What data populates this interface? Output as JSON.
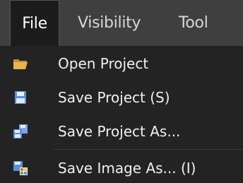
{
  "menubar": {
    "items": [
      {
        "label": "File",
        "active": true
      },
      {
        "label": "Visibility",
        "active": false
      },
      {
        "label": "Tool",
        "active": false
      }
    ]
  },
  "file_menu": {
    "items": [
      {
        "label": "Open Project",
        "icon": "folder-open-icon"
      },
      {
        "label": "Save Project (S)",
        "icon": "floppy-disk-icon"
      },
      {
        "label": "Save Project As...",
        "icon": "floppy-disk-stack-icon"
      },
      {
        "label": "Save Image As... (I)",
        "icon": "save-image-icon"
      }
    ]
  },
  "colors": {
    "menubar_bg": "#3f3f3f",
    "dropdown_bg": "#232323",
    "icon_blue": "#5b8fd6",
    "folder_yellow": "#e8b54a"
  }
}
